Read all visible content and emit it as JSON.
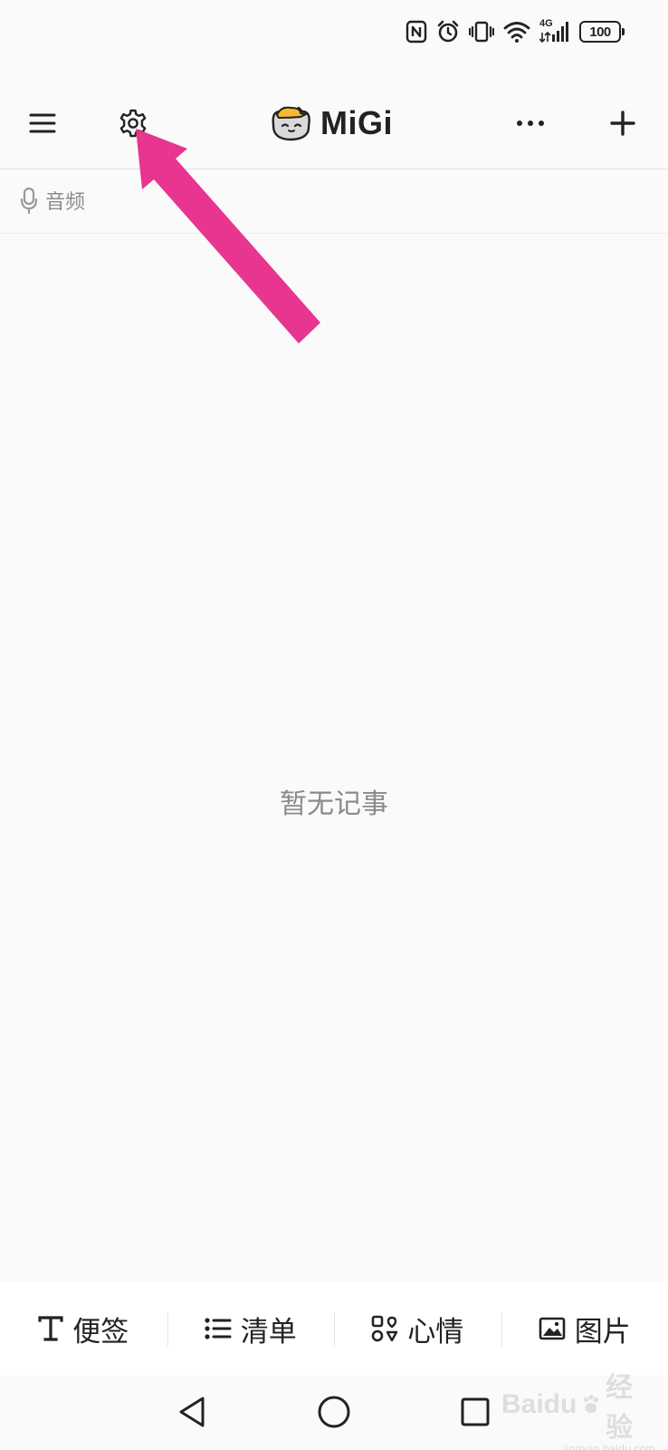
{
  "status_bar": {
    "network": "4G",
    "battery": "100"
  },
  "header": {
    "brand_name": "MiGi",
    "icons": {
      "menu": "hamburger-menu-icon",
      "settings": "gear-icon",
      "more": "more-dots-icon",
      "add": "plus-icon",
      "logo": "cat-mascot-icon"
    }
  },
  "filter": {
    "label": "音频",
    "icon": "microphone-icon"
  },
  "empty_state": {
    "text": "暂无记事"
  },
  "bottom_bar": {
    "items": [
      {
        "label": "便签",
        "icon": "text-t-icon"
      },
      {
        "label": "清单",
        "icon": "list-icon"
      },
      {
        "label": "心情",
        "icon": "mood-grid-icon"
      },
      {
        "label": "图片",
        "icon": "image-icon"
      }
    ]
  },
  "annotation": {
    "arrow_color": "#e8358f",
    "target": "settings"
  },
  "watermark": {
    "brand": "Baidu",
    "suffix": "经验",
    "sub": "jingyan.baidu.com"
  }
}
